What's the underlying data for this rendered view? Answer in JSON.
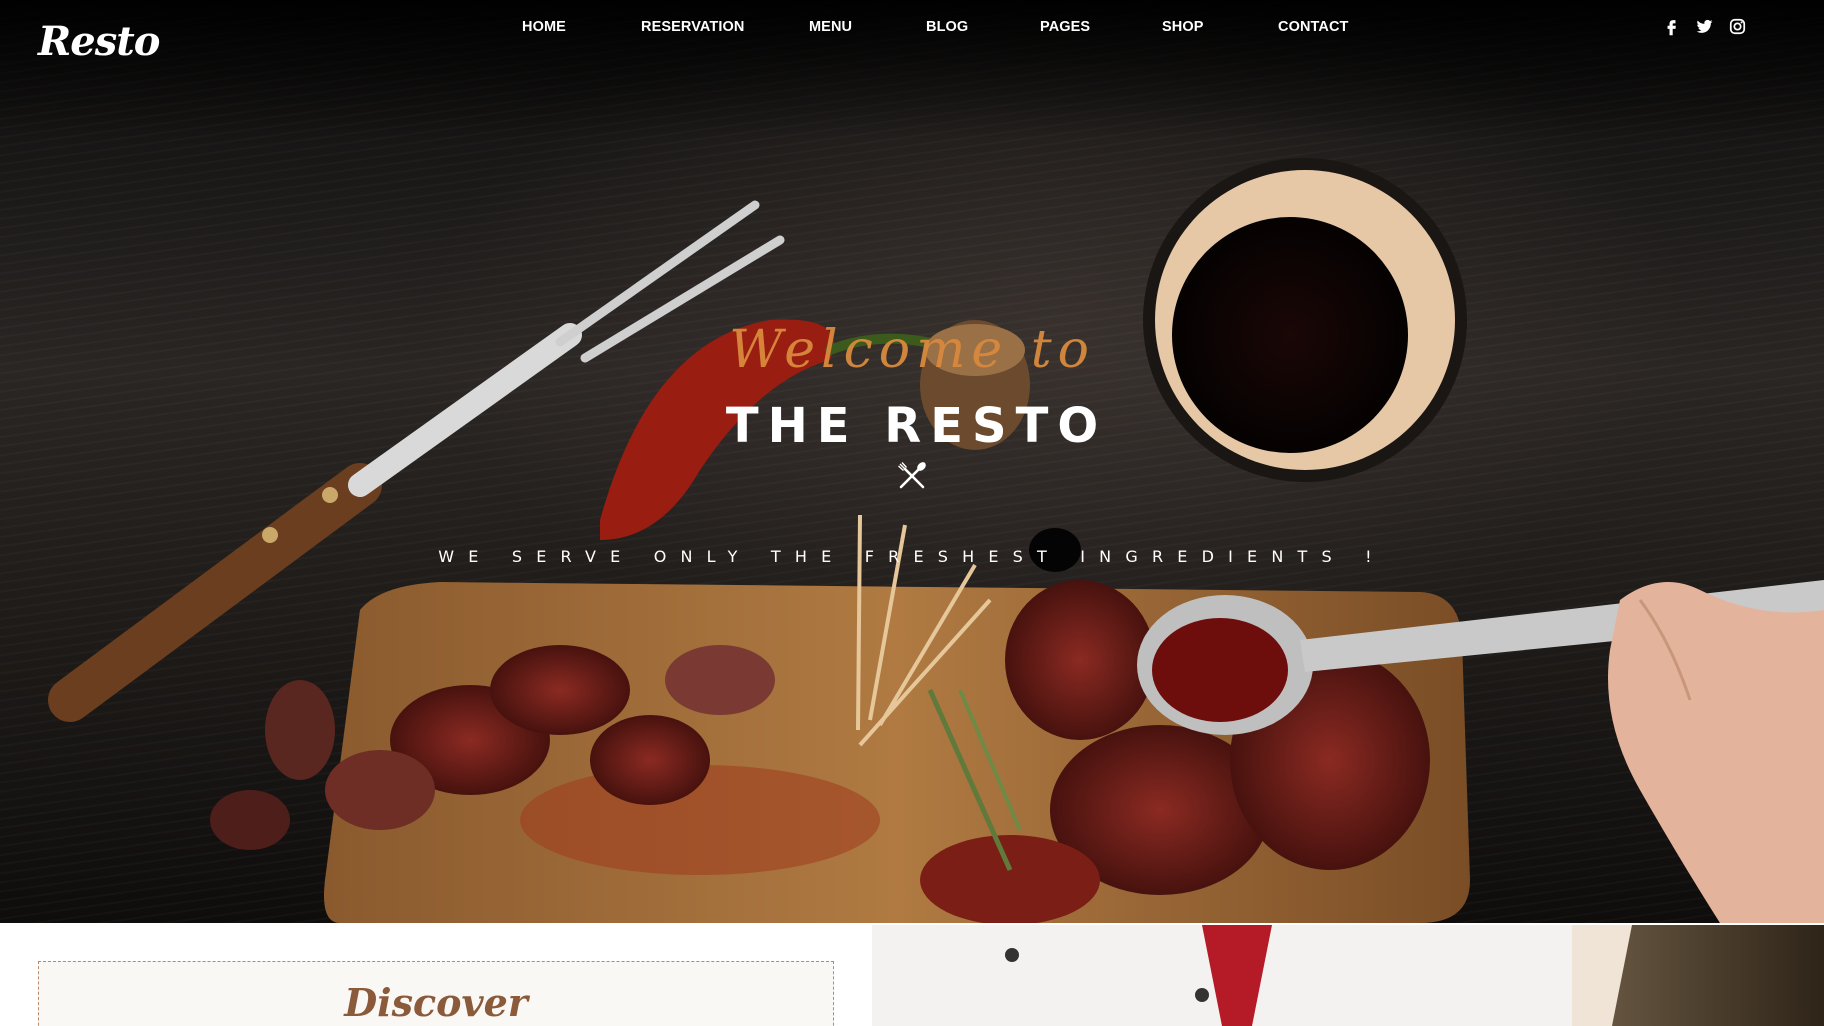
{
  "brand": {
    "logo_text": "Resto"
  },
  "nav": {
    "items": [
      {
        "label": "HOME"
      },
      {
        "label": "RESERVATION"
      },
      {
        "label": "MENU"
      },
      {
        "label": "BLOG"
      },
      {
        "label": "PAGES"
      },
      {
        "label": "SHOP"
      },
      {
        "label": "CONTACT"
      }
    ]
  },
  "social": [
    {
      "icon": "facebook-icon"
    },
    {
      "icon": "twitter-icon"
    },
    {
      "icon": "instagram-icon"
    }
  ],
  "hero": {
    "welcome": "Welcome to",
    "title": "THE RESTO",
    "divider_icon": "fork-spoon-crossed-icon",
    "tagline": "WE SERVE ONLY THE FRESHEST INGREDIENTS !",
    "accent_color": "#d98a3d"
  },
  "discover": {
    "title": "Discover",
    "color": "#8a5a3b"
  }
}
